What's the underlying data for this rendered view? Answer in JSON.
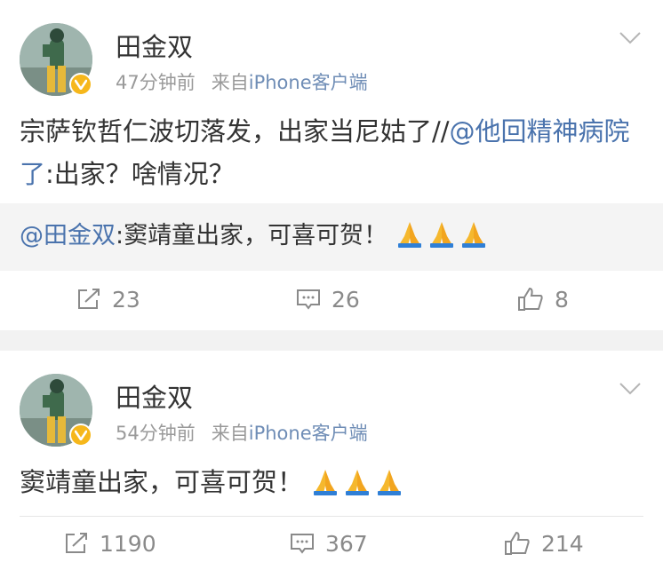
{
  "posts": [
    {
      "username": "田金双",
      "time": "47分钟前",
      "source_prefix": "来自",
      "source": "iPhone客户端",
      "content_text": "宗萨钦哲仁波切落发，出家当尼姑了//",
      "content_mention": "@他回精神病院了",
      "content_tail": ":出家？啥情况？",
      "repost_mention": "@田金双",
      "repost_text": ":窦靖童出家，可喜可贺！",
      "counts": {
        "repost": "23",
        "comment": "26",
        "like": "8"
      }
    },
    {
      "username": "田金双",
      "time": "54分钟前",
      "source_prefix": "来自",
      "source": "iPhone客户端",
      "content_text": "窦靖童出家，可喜可贺！",
      "counts": {
        "repost": "1190",
        "comment": "367",
        "like": "214"
      }
    }
  ],
  "colors": {
    "link": "#4a73ad",
    "meta": "#9a9a9a",
    "badge": "#f6b71b"
  },
  "icons": [
    "chevron-down-icon",
    "repost-icon",
    "comment-icon",
    "like-icon",
    "verified-badge-icon",
    "praying-hands-icon"
  ]
}
